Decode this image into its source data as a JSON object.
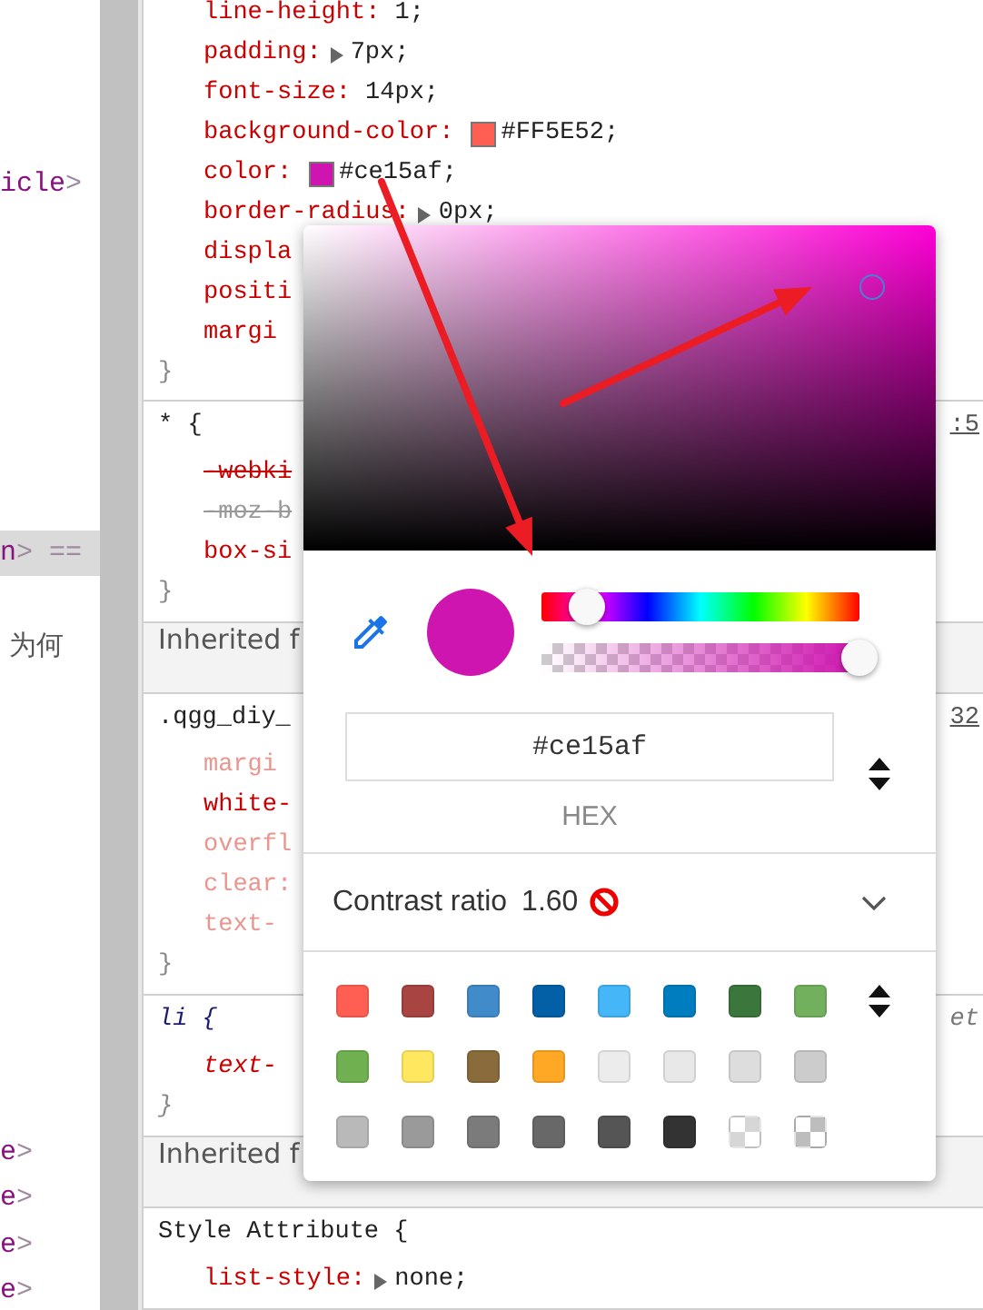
{
  "elements_panel": {
    "rows": [
      {
        "parts": [
          {
            "text": "icle",
            "kind": "tag"
          },
          {
            "text": ">",
            "kind": "punct"
          }
        ],
        "selected": false
      },
      {
        "parts": [
          {
            "text": "n",
            "kind": "tag"
          },
          {
            "text": "> ==",
            "kind": "punct"
          }
        ],
        "selected": true
      },
      {
        "parts": [
          {
            "text": "为何",
            "kind": "text"
          }
        ],
        "selected": false
      },
      {
        "parts": [
          {
            "text": "e",
            "kind": "tag"
          },
          {
            "text": ">",
            "kind": "punct"
          }
        ],
        "selected": false
      },
      {
        "parts": [
          {
            "text": "e",
            "kind": "tag"
          },
          {
            "text": ">",
            "kind": "punct"
          }
        ],
        "selected": false
      },
      {
        "parts": [
          {
            "text": "e",
            "kind": "tag"
          },
          {
            "text": ">",
            "kind": "punct"
          }
        ],
        "selected": false
      },
      {
        "parts": [
          {
            "text": "e",
            "kind": "tag"
          },
          {
            "text": ">",
            "kind": "punct"
          }
        ],
        "selected": false
      }
    ]
  },
  "styles": {
    "sections": [
      {
        "kind": "rule",
        "declarations": [
          {
            "name": "line-height:",
            "value": "1;",
            "overridden": false,
            "inactive": false
          },
          {
            "name": "padding:",
            "value": "7px;",
            "expandable": true,
            "overridden": false,
            "inactive": false
          },
          {
            "name": "font-size:",
            "value": "14px;",
            "overridden": false,
            "inactive": false
          },
          {
            "name": "background-color:",
            "color": "#ff5e52",
            "value": "#FF5E52;",
            "overridden": false,
            "inactive": false
          },
          {
            "name": "color:",
            "color": "#ce15af",
            "value": "#ce15af;",
            "overridden": false,
            "inactive": false
          },
          {
            "name": "border-radius:",
            "value": "0px;",
            "expandable": true,
            "overridden": false,
            "inactive": false
          },
          {
            "name": "displa",
            "overridden": false,
            "inactive": false
          },
          {
            "name": "positi",
            "overridden": false,
            "inactive": false
          },
          {
            "name": "margi",
            "overridden": false,
            "inactive": false
          }
        ],
        "closing": "}"
      },
      {
        "kind": "rule",
        "selector": "* {",
        "source": ":5",
        "user_agent": false,
        "declarations": [
          {
            "name": "-webki",
            "overridden": true,
            "inactive": false
          },
          {
            "name": "-moz-b",
            "overridden": true,
            "inactive": true
          },
          {
            "name": "box-si",
            "overridden": false,
            "inactive": false
          }
        ],
        "closing": "}"
      },
      {
        "kind": "header",
        "text": "Inherited f"
      },
      {
        "kind": "rule",
        "selector": ".qgg_diy_",
        "source": "32",
        "user_agent": false,
        "declarations": [
          {
            "name": "margi",
            "overridden": false,
            "inactive": true
          },
          {
            "name": "white-",
            "overridden": false,
            "inactive": false
          },
          {
            "name": "overfl",
            "overridden": false,
            "inactive": true
          },
          {
            "name": "clear:",
            "overridden": false,
            "inactive": true
          },
          {
            "name": "text-",
            "overridden": false,
            "inactive": true
          }
        ],
        "closing": "}"
      },
      {
        "kind": "rule",
        "selector": "li {",
        "source": "et",
        "user_agent": true,
        "declarations": [
          {
            "name": "text-",
            "overridden": false,
            "inactive": false
          }
        ],
        "closing": "}"
      },
      {
        "kind": "header",
        "text": "Inherited f"
      },
      {
        "kind": "rule",
        "selector": "Style Attribute {",
        "user_agent": false,
        "declarations": [
          {
            "name": "list-style:",
            "value": "none;",
            "expandable": true,
            "overridden": false,
            "inactive": false
          }
        ]
      }
    ]
  },
  "color_picker": {
    "hex": {
      "value": "#ce15af",
      "format": "HEX"
    },
    "hue": {
      "level": 0.14
    },
    "alpha": {
      "level": 1
    },
    "contrast": {
      "label": "Contrast ratio",
      "value": "1.60",
      "passes": false,
      "expanded": false
    },
    "palette": [
      {
        "color": "#ff5e52",
        "kind": "solid"
      },
      {
        "color": "#a84442",
        "kind": "solid"
      },
      {
        "color": "#428bca",
        "kind": "solid"
      },
      {
        "color": "#0460a6",
        "kind": "solid"
      },
      {
        "color": "#45b6f7",
        "kind": "solid"
      },
      {
        "color": "#007dbf",
        "kind": "solid"
      },
      {
        "color": "#3b763d",
        "kind": "solid"
      },
      {
        "color": "#72b05e",
        "kind": "solid"
      },
      {
        "color": "#70b050",
        "kind": "solid"
      },
      {
        "color": "#ffe760",
        "kind": "solid"
      },
      {
        "color": "#8a6b3b",
        "kind": "solid"
      },
      {
        "color": "#ffa826",
        "kind": "solid"
      },
      {
        "color": "#ececec",
        "kind": "solid"
      },
      {
        "color": "#e8e8e8",
        "kind": "solid"
      },
      {
        "color": "#dddddd",
        "kind": "solid"
      },
      {
        "color": "#cccccc",
        "kind": "solid"
      },
      {
        "color": "#b9b9b9",
        "kind": "solid"
      },
      {
        "color": "#9a9a9a",
        "kind": "solid"
      },
      {
        "color": "#7b7b7b",
        "kind": "solid"
      },
      {
        "color": "#686868",
        "kind": "solid"
      },
      {
        "color": "#555555",
        "kind": "solid"
      },
      {
        "color": "#333333",
        "kind": "solid"
      },
      {
        "color": "#d6d6d6",
        "kind": "checker"
      },
      {
        "color": "#bdbdbd",
        "kind": "checker"
      }
    ]
  },
  "annotations": [
    {
      "kind": "arrow"
    },
    {
      "kind": "arrow"
    }
  ]
}
